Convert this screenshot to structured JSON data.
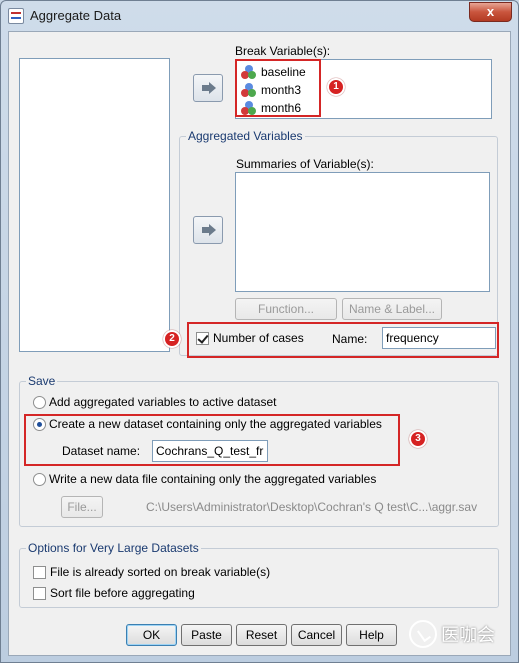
{
  "window": {
    "title": "Aggregate Data",
    "close_glyph": "x"
  },
  "break_variables": {
    "label": "Break Variable(s):",
    "items": [
      "baseline",
      "month3",
      "month6"
    ],
    "badge": "1"
  },
  "aggregated": {
    "legend": "Aggregated Variables",
    "summaries_label": "Summaries of Variable(s):",
    "function_button": "Function...",
    "name_label_button": "Name & Label...",
    "number_of_cases_label": "Number of cases",
    "number_of_cases_checked": true,
    "name_label": "Name:",
    "name_value": "frequency",
    "badge": "2"
  },
  "save": {
    "legend": "Save",
    "option_add": "Add aggregated variables to active dataset",
    "option_create": "Create a new dataset containing only the aggregated variables",
    "dataset_name_label": "Dataset name:",
    "dataset_name_value": "Cochrans_Q_test_fr",
    "option_write": "Write a new data file containing only the aggregated variables",
    "file_button": "File...",
    "file_path": "C:\\Users\\Administrator\\Desktop\\Cochran's Q test\\C...\\aggr.sav",
    "selected": "create",
    "badge": "3"
  },
  "large": {
    "legend": "Options for Very Large Datasets",
    "sorted_label": "File is already sorted on break variable(s)",
    "sort_label": "Sort file before aggregating"
  },
  "buttons": {
    "ok": "OK",
    "paste": "Paste",
    "reset": "Reset",
    "cancel": "Cancel",
    "help": "Help"
  },
  "watermark": {
    "text": "医咖会"
  },
  "colors": {
    "highlight_red": "#d42626",
    "badge_red": "#d62222",
    "group_legend": "#1a3a70"
  },
  "icons": [
    "app-icon",
    "close-icon",
    "arrow-right-icon",
    "scale-variable-icon",
    "watermark-logo-icon"
  ]
}
